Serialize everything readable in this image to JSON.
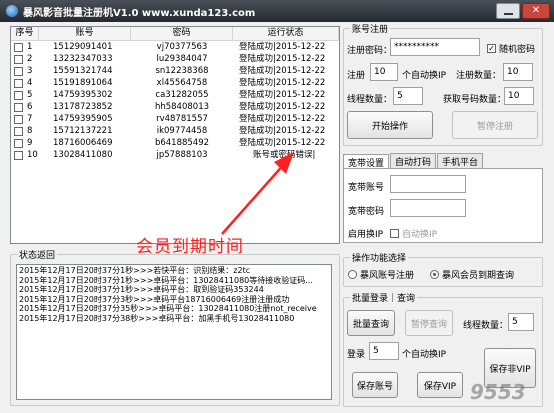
{
  "window": {
    "title": "暴风影音批量注册机V1.0  www.xunda123.com",
    "close_label": "✕"
  },
  "table": {
    "headers": [
      "序号",
      "账号",
      "密码",
      "运行状态"
    ],
    "rows": [
      {
        "no": "1",
        "account": "15129091401",
        "password": "vj70377563",
        "status": "登陆成功|2015-12-22",
        "checked": false
      },
      {
        "no": "2",
        "account": "13232347033",
        "password": "lu29384047",
        "status": "登陆成功|2015-12-22",
        "checked": false
      },
      {
        "no": "3",
        "account": "15591321744",
        "password": "sn12238368",
        "status": "登陆成功|2015-12-22",
        "checked": false
      },
      {
        "no": "4",
        "account": "15191891064",
        "password": "xl45564758",
        "status": "登陆成功|2015-12-22",
        "checked": false
      },
      {
        "no": "5",
        "account": "14759395302",
        "password": "ca31282055",
        "status": "登陆成功|2015-12-22",
        "checked": false
      },
      {
        "no": "6",
        "account": "13178723852",
        "password": "hh58408013",
        "status": "登陆成功|2015-12-22",
        "checked": false
      },
      {
        "no": "7",
        "account": "14759395905",
        "password": "rv48781557",
        "status": "登陆成功|2015-12-22",
        "checked": false
      },
      {
        "no": "8",
        "account": "15712137221",
        "password": "ik09774458",
        "status": "登陆成功|2015-12-22",
        "checked": false
      },
      {
        "no": "9",
        "account": "18716006469",
        "password": "b641885492",
        "status": "登陆成功|2015-12-22",
        "checked": false
      },
      {
        "no": "10",
        "account": "13028411080",
        "password": "jp57888103",
        "status": "账号或密码错误|",
        "checked": false
      }
    ]
  },
  "annotation": "会员到期时间",
  "status_log": {
    "title": "状态返回",
    "lines": [
      "2015年12月17日20时37分1秒>>>若快平台：识别结果：z2tc",
      "2015年12月17日20时37分1秒>>>卓码平台：13028411080等待接收验证码...",
      "2015年12月17日20时37分1秒>>>卓码平台：取到验证码353244",
      "2015年12月17日20时37分3秒>>>卓码平台18716006469注册注册成功",
      "2015年12月17日20时37分35秒>>>卓码平台：13028411080注册not_receive",
      "2015年12月17日20时37分38秒>>>卓码平台：加黑手机号13028411080"
    ]
  },
  "account_reg": {
    "title": "账号注册",
    "password_label": "注册密码：",
    "password_value": "**********",
    "random_password_label": "随机密码",
    "random_password_checked": true,
    "register_label": "注册",
    "register_value": "10",
    "auto_ip_label": "个自动换IP",
    "register_count_label": "注册数量：",
    "register_count_value": "10",
    "thread_label": "线程数量：",
    "thread_value": "5",
    "fetch_count_label": "获取号码数量：",
    "fetch_count_value": "10",
    "start_button": "开始操作",
    "pause_button": "暂停注册"
  },
  "tabs": {
    "items": [
      "宽带设置",
      "自动打码",
      "手机平台"
    ],
    "broadband_account_label": "宽带账号",
    "broadband_account_value": "",
    "broadband_password_label": "宽带密码",
    "broadband_password_value": "",
    "enable_ip_label": "启用换IP",
    "auto_ip_label": "自动换IP",
    "auto_ip_checked": false
  },
  "function_select": {
    "title": "操作功能选择",
    "option_register": "暴风账号注册",
    "option_member": "暴风会员到期查询",
    "selected": "member"
  },
  "batch_login": {
    "title": "批量登录｜查询",
    "batch_query_button": "批量查询",
    "pause_query_button": "暂停查询",
    "thread_label": "线程数量：",
    "thread_value": "5",
    "login_label": "登录",
    "login_value": "5",
    "auto_ip_label": "个自动换IP",
    "save_account_button": "保存账号",
    "save_vip_button": "保存VIP",
    "save_non_vip_button": "保存非VIP"
  },
  "watermark": "9553"
}
